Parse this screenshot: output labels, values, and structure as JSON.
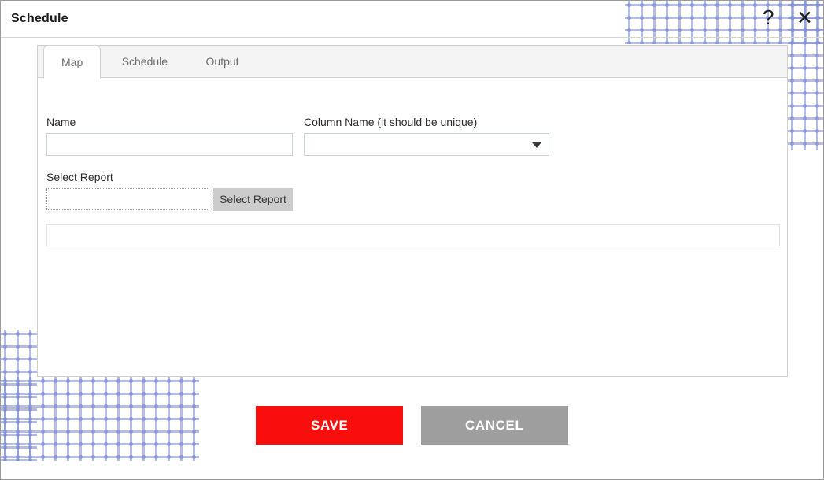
{
  "window": {
    "title": "Schedule",
    "help_icon": "help-question-mark",
    "help_glyph": "?",
    "close_icon": "close-x",
    "close_glyph": "✕"
  },
  "tabs": [
    {
      "label": "Map",
      "active": true
    },
    {
      "label": "Schedule",
      "active": false
    },
    {
      "label": "Output",
      "active": false
    }
  ],
  "form": {
    "name": {
      "label": "Name",
      "value": "",
      "placeholder": ""
    },
    "column_name": {
      "label": "Column Name (it should be unique)",
      "value": "",
      "placeholder": "",
      "arrow_icon": "chevron-down-icon"
    },
    "select_report": {
      "label": "Select Report",
      "value": "",
      "placeholder": "",
      "button_label": "Select Report"
    },
    "report_path": {
      "value": "",
      "placeholder": ""
    }
  },
  "footer": {
    "save_label": "SAVE",
    "cancel_label": "CANCEL"
  },
  "colors": {
    "save_red": "#fa0d0d",
    "cancel_gray": "#9e9e9e",
    "select_report_button": "#cccccc",
    "tabstrip_bg": "#f4f4f4",
    "dot_pattern": "#8894d6",
    "panel_border": "#cfcfcf"
  }
}
